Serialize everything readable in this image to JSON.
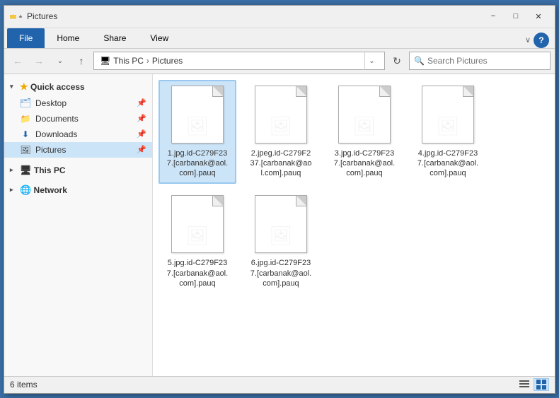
{
  "titlebar": {
    "title": "Pictures",
    "minimize_label": "−",
    "maximize_label": "□",
    "close_label": "✕"
  },
  "ribbon": {
    "tabs": [
      "File",
      "Home",
      "Share",
      "View"
    ],
    "active_tab": "File",
    "expand_icon": "∨",
    "help_icon": "?"
  },
  "addressbar": {
    "back_icon": "←",
    "forward_icon": "→",
    "dropdown_icon": "∨",
    "up_icon": "↑",
    "this_pc": "This PC",
    "pictures": "Pictures",
    "path_chevron": "›",
    "refresh_icon": "↻",
    "search_placeholder": "Search Pictures"
  },
  "sidebar": {
    "quick_access_label": "Quick access",
    "items": [
      {
        "label": "Desktop",
        "pinned": true,
        "type": "desktop"
      },
      {
        "label": "Documents",
        "pinned": true,
        "type": "documents"
      },
      {
        "label": "Downloads",
        "pinned": true,
        "type": "downloads"
      },
      {
        "label": "Pictures",
        "pinned": true,
        "type": "pictures",
        "active": true
      }
    ],
    "this_pc_label": "This PC",
    "network_label": "Network"
  },
  "files": [
    {
      "name": "1.jpg.id-C279F23\n7.[carbanak@aol.\ncom].pauq"
    },
    {
      "name": "2.jpeg.id-C279F2\n37.[carbanak@ao\nl.com].pauq"
    },
    {
      "name": "3.jpg.id-C279F23\n7.[carbanak@aol.\ncom].pauq"
    },
    {
      "name": "4.jpg.id-C279F23\n7.[carbanak@aol.\ncom].pauq"
    },
    {
      "name": "5.jpg.id-C279F23\n7.[carbanak@aol.\ncom].pauq"
    },
    {
      "name": "6.jpg.id-C279F23\n7.[carbanak@aol.\ncom].pauq"
    }
  ],
  "statusbar": {
    "count_text": "6 items"
  }
}
